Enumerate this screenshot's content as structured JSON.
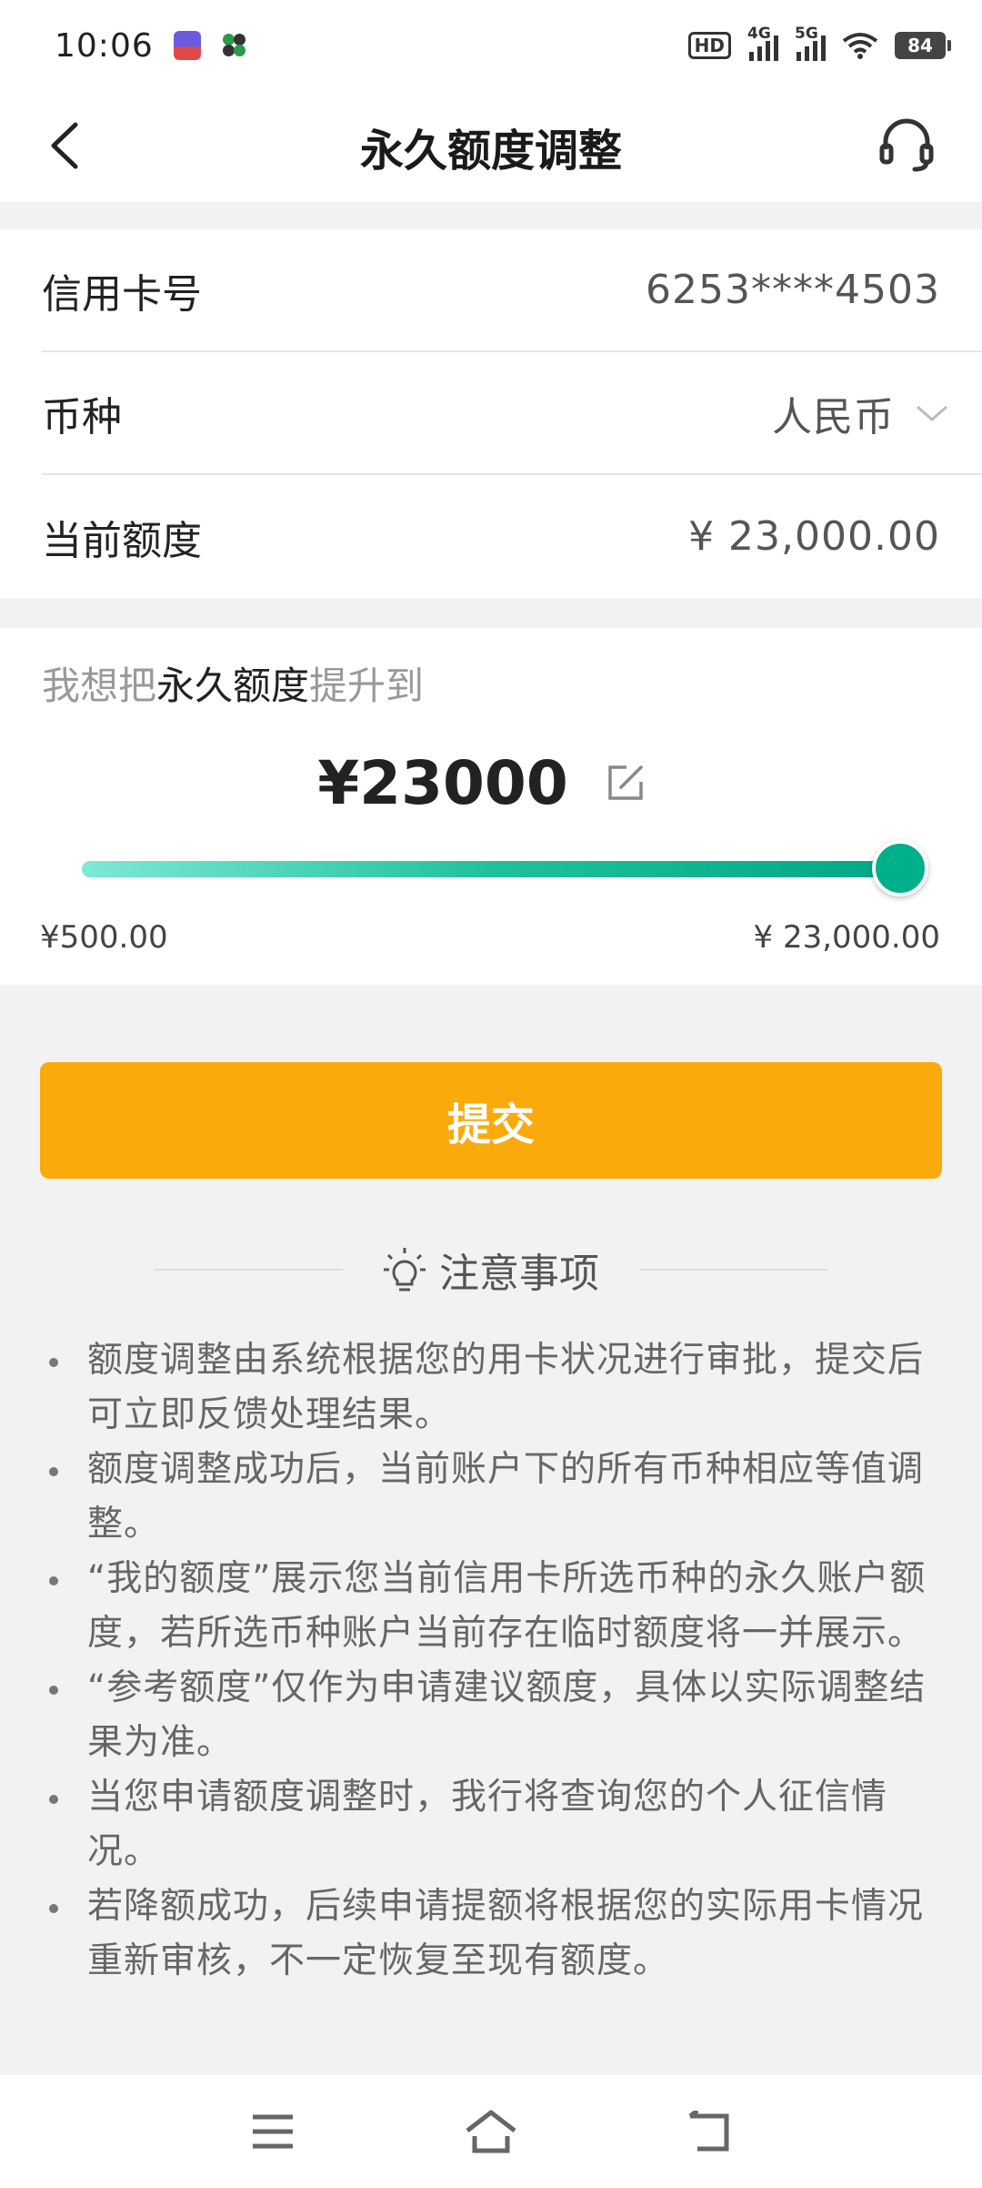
{
  "status_bar": {
    "time": "10:06",
    "hd_label": "HD",
    "signal_1_label": "4G",
    "signal_2_label": "5G",
    "battery": "84"
  },
  "nav": {
    "title": "永久额度调整"
  },
  "info": {
    "card_number_label": "信用卡号",
    "card_number_value": "6253****4503",
    "currency_label": "币种",
    "currency_value": "人民币",
    "current_limit_label": "当前额度",
    "current_limit_value": "¥ 23,000.00"
  },
  "adjust": {
    "prompt_prefix": "我想把",
    "prompt_highlight": "永久额度",
    "prompt_suffix": "提升到",
    "amount": "¥23000",
    "slider_fraction": 1.0,
    "range_min": "¥500.00",
    "range_max": "¥ 23,000.00"
  },
  "submit": {
    "label": "提交"
  },
  "notice": {
    "title": "注意事项",
    "items": [
      "额度调整由系统根据您的用卡状况进行审批，提交后可立即反馈处理结果。",
      "额度调整成功后，当前账户下的所有币种相应等值调整。",
      "“我的额度”展示您当前信用卡所选币种的永久账户额度，若所选币种账户当前存在临时额度将一并展示。",
      "“参考额度”仅作为申请建议额度，具体以实际调整结果为准。",
      "当您申请额度调整时，我行将查询您的个人征信情况。",
      "若降额成功，后续申请提额将根据您的实际用卡情况重新审核，不一定恢复至现有额度。"
    ]
  },
  "colors": {
    "accent_orange": "#fbaa0c",
    "slider_green": "#00b08a"
  }
}
